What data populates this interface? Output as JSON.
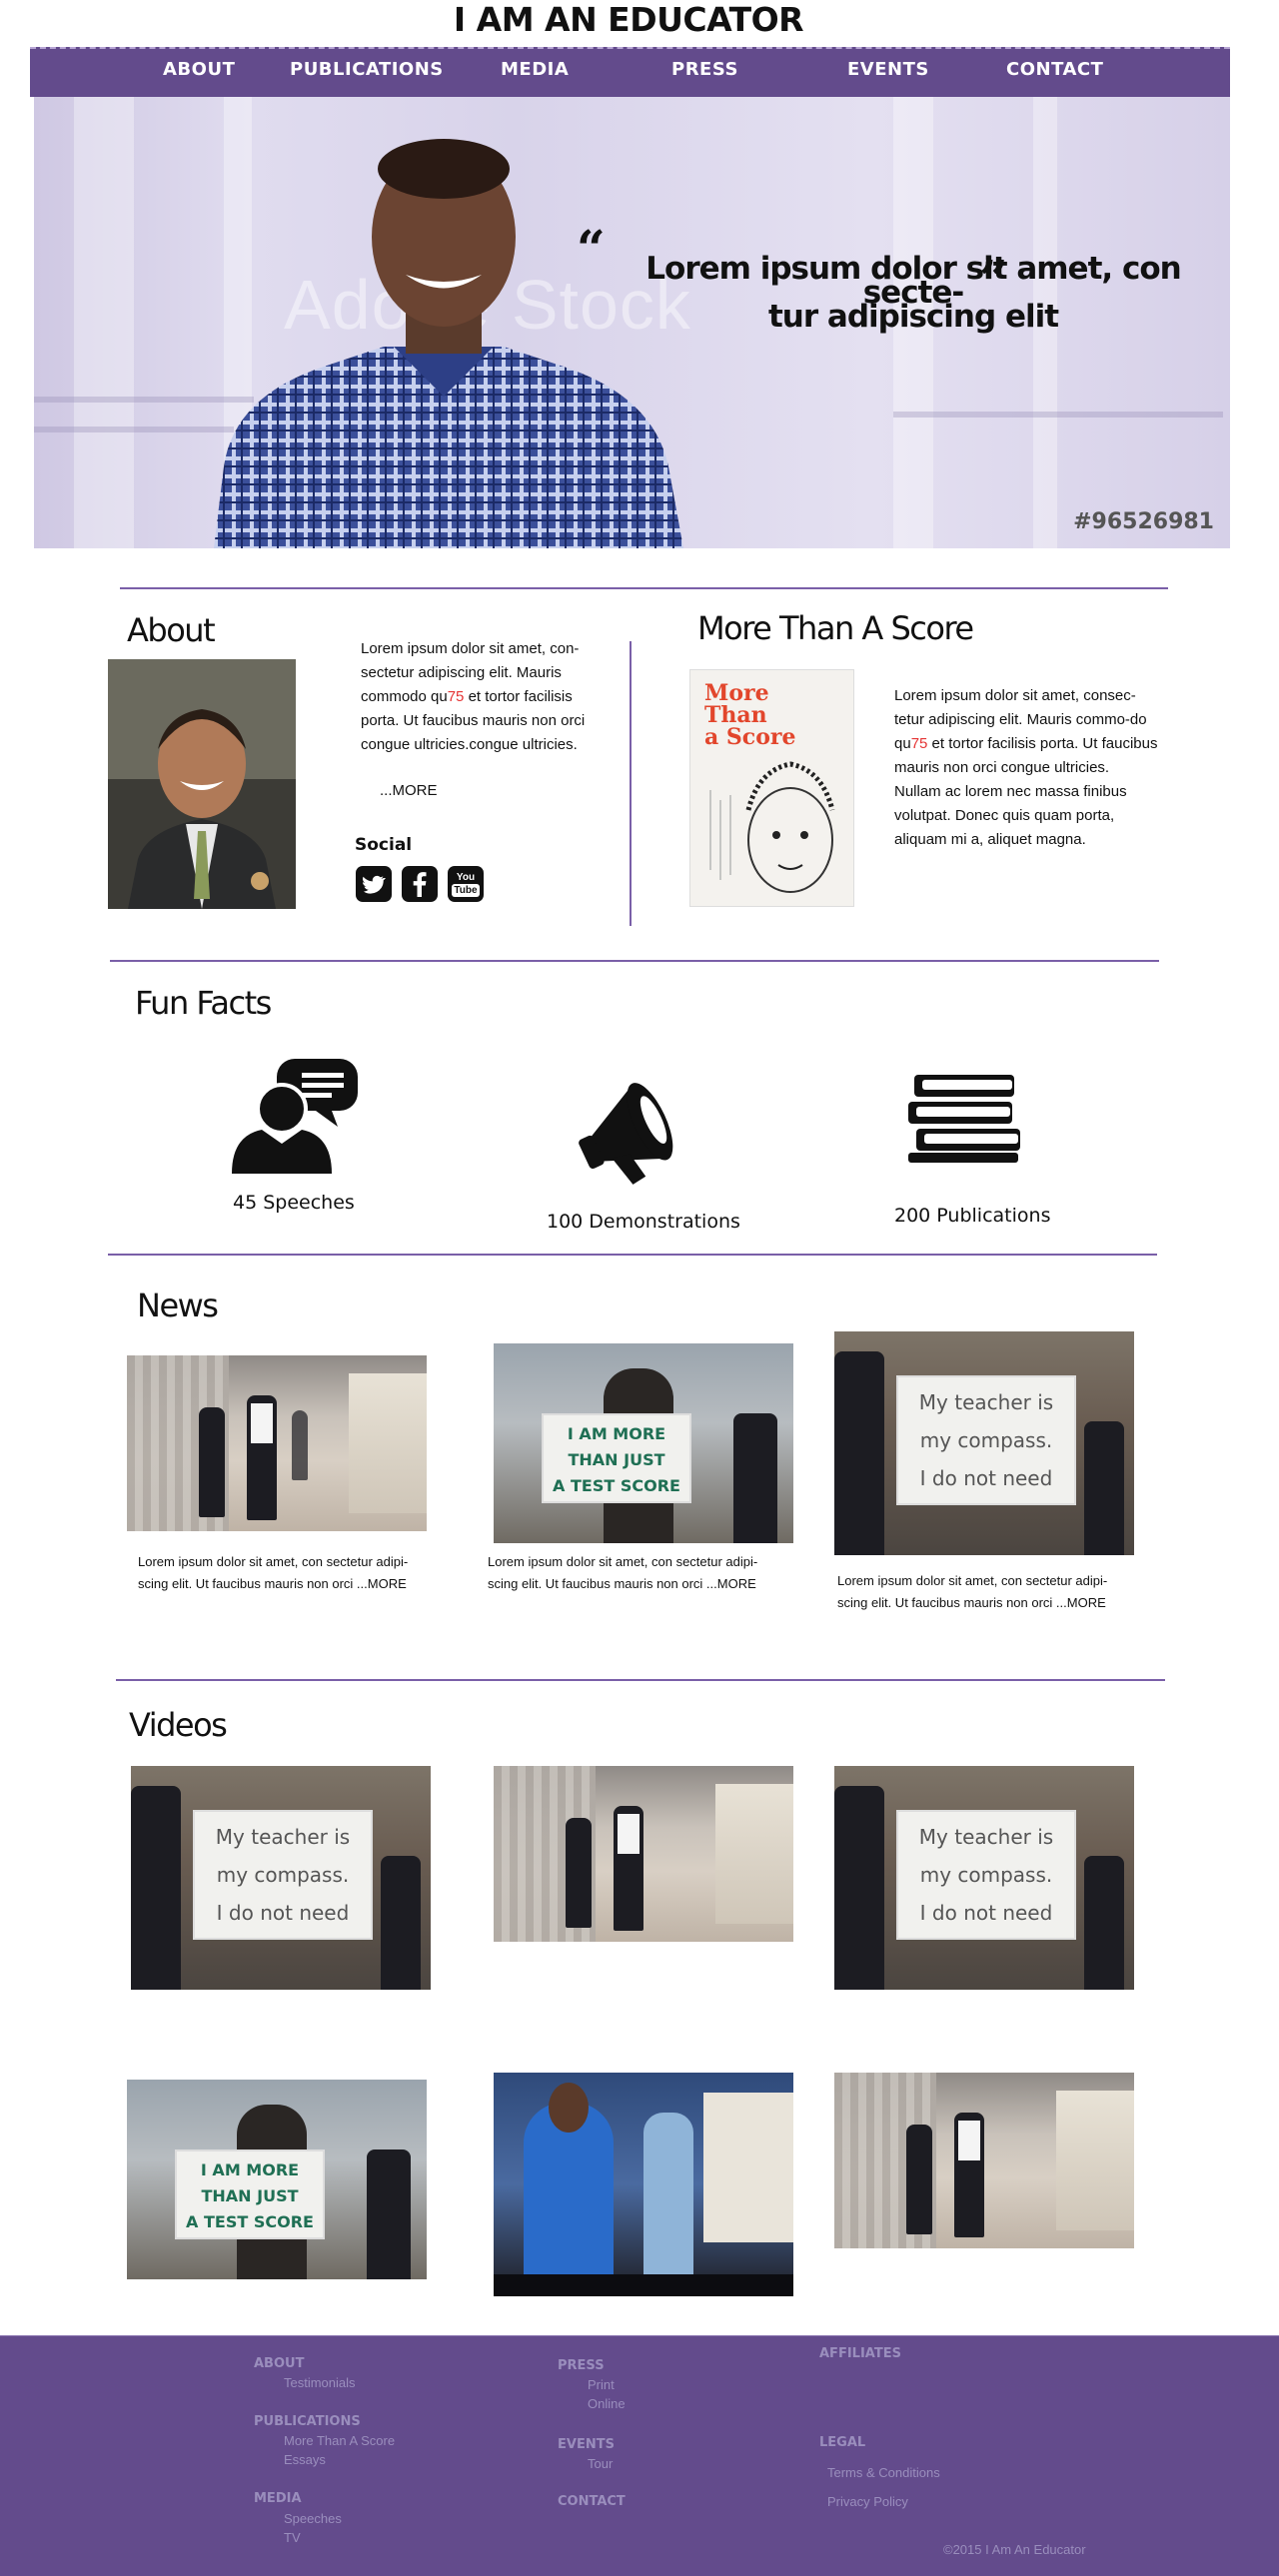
{
  "site_title": "I AM AN EDUCATOR",
  "nav": [
    "ABOUT",
    "PUBLICATIONS",
    "MEDIA",
    "PRESS",
    "EVENTS",
    "CONTACT"
  ],
  "hero": {
    "quote_line1": "Lorem ipsum dolor sit amet, con secte-",
    "quote_line2": "tur adipiscing elit",
    "watermark": "Adobe Stock",
    "stock_id": "#96526981"
  },
  "about": {
    "heading": "About",
    "text_before_red": "Lorem ipsum dolor sit amet, con-sectetur adipiscing elit. Mauris commodo qu",
    "text_red": "75",
    "text_after_red": " et tortor facilisis porta. Ut faucibus mauris non orci congue ultricies.congue ultricies.",
    "more": "...MORE",
    "social_label": "Social",
    "social_icons": [
      "twitter-icon",
      "facebook-icon",
      "youtube-icon"
    ],
    "youtube_you": "You",
    "youtube_tube": "Tube"
  },
  "score": {
    "heading": "More Than A Score",
    "book_title_lines": [
      "More",
      "Than",
      "a Score"
    ],
    "text_before_red": "Lorem ipsum dolor sit amet, consec-tetur adipiscing elit. Mauris commo-do qu",
    "text_red": "75",
    "text_after_red": " et tortor facilisis porta. Ut faucibus mauris non orci congue ultricies. Nullam ac lorem nec massa finibus volutpat. Donec quis quam porta, aliquam mi a, aliquet magna."
  },
  "fun_facts": {
    "heading": "Fun Facts",
    "items": [
      {
        "label": "45 Speeches",
        "icon": "speaker-icon"
      },
      {
        "label": "100 Demonstrations",
        "icon": "megaphone-icon"
      },
      {
        "label": "200 Publications",
        "icon": "books-icon"
      }
    ]
  },
  "news": {
    "heading": "News",
    "captions": [
      "Lorem ipsum dolor sit amet, con sectetur adipi-scing elit. Ut faucibus mauris non orci ...MORE",
      "Lorem ipsum dolor sit amet, con sectetur adipi-scing elit. Ut faucibus mauris non orci ...MORE",
      "Lorem ipsum dolor sit amet, con sectetur adipi-scing elit. Ut faucibus mauris non orci ...MORE"
    ]
  },
  "videos": {
    "heading": "Videos"
  },
  "signs": {
    "score_lines": [
      "I AM MORE",
      "THAN JUST",
      "A TEST SCORE"
    ],
    "compass_lines": [
      "My teacher is",
      "my compass.",
      "I do not need"
    ]
  },
  "footer": {
    "col1": [
      {
        "heading": "ABOUT",
        "items": [
          "Testimonials"
        ]
      },
      {
        "heading": "PUBLICATIONS",
        "items": [
          "More Than A Score",
          "Essays"
        ]
      },
      {
        "heading": "MEDIA",
        "items": [
          "Speeches",
          "TV"
        ]
      }
    ],
    "col2": [
      {
        "heading": "PRESS",
        "items": [
          "Print",
          "Online"
        ]
      },
      {
        "heading": "EVENTS",
        "items": [
          "Tour"
        ]
      },
      {
        "heading": "CONTACT",
        "items": []
      }
    ],
    "col3": [
      {
        "heading": "AFFILIATES",
        "items": []
      },
      {
        "heading": "LEGAL",
        "items": [
          "Terms & Conditions",
          "Privacy Policy"
        ]
      }
    ],
    "copyright": "©2015  I Am An Educator"
  },
  "colors": {
    "accent_purple": "#634b8c",
    "divider_purple": "#7a5fa8",
    "highlight_red": "#e53535"
  }
}
